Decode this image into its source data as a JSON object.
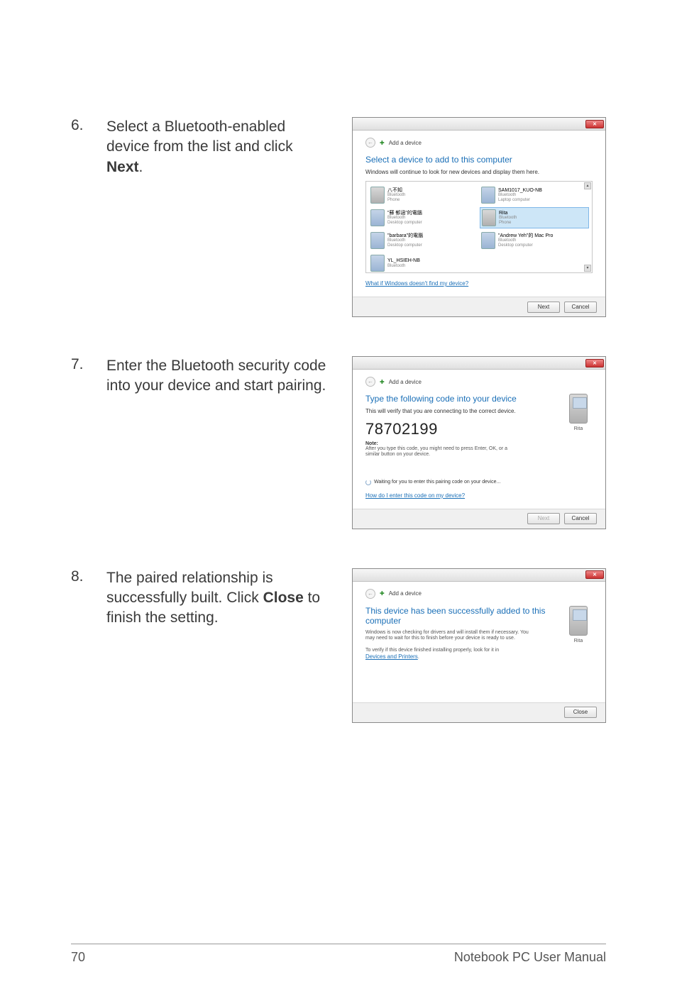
{
  "steps": {
    "s6": {
      "num": "6.",
      "text_pre": "Select a Bluetooth-enabled device from the list and click ",
      "bold": "Next",
      "text_post": "."
    },
    "s7": {
      "num": "7.",
      "text": "Enter the Bluetooth security code into your device and start pairing."
    },
    "s8": {
      "num": "8.",
      "text_pre": "The paired relationship is successfully built. Click ",
      "bold": "Close",
      "text_post": " to finish the setting."
    }
  },
  "dialog_common": {
    "crumb_icon_label": "←",
    "crumb": "Add a device",
    "close_x": "✕"
  },
  "dialog1": {
    "title": "Select a device to add to this computer",
    "subtitle": "Windows will continue to look for new devices and display them here.",
    "devices": [
      {
        "name": "八不知",
        "type1": "Bluetooth",
        "type2": "Phone",
        "icon": "phone"
      },
      {
        "name": "SAM1017_KUO-NB",
        "type1": "Bluetooth",
        "type2": "Laptop computer",
        "icon": "laptop"
      },
      {
        "name": "\"蘇 郁涵\"的電腦",
        "type1": "Bluetooth",
        "type2": "Desktop computer",
        "icon": "laptop"
      },
      {
        "name": "Rita",
        "type1": "Bluetooth",
        "type2": "Phone",
        "icon": "phone",
        "selected": true
      },
      {
        "name": "\"barbara\"的電腦",
        "type1": "Bluetooth",
        "type2": "Desktop computer",
        "icon": "laptop"
      },
      {
        "name": "\"Andrew Yeh\"的 Mac Pro",
        "type1": "Bluetooth",
        "type2": "Desktop computer",
        "icon": "laptop"
      },
      {
        "name": "YL_HSIEH-NB",
        "type1": "Bluetooth",
        "type2": "",
        "icon": "laptop"
      }
    ],
    "link": "What if Windows doesn't find my device?",
    "btn_next": "Next",
    "btn_cancel": "Cancel"
  },
  "dialog2": {
    "title": "Type the following code into your device",
    "subtitle": "This will verify that you are connecting to the correct device.",
    "code": "78702199",
    "note_label": "Note:",
    "note": "After you type this code, you might need to press Enter, OK, or a similar button on your device.",
    "device_name": "Rita",
    "waiting": "Waiting for you to enter this pairing code on your device...",
    "link": "How do I enter this code on my device?",
    "btn_next": "Next",
    "btn_cancel": "Cancel"
  },
  "dialog3": {
    "title": "This device has been successfully added to this computer",
    "line1": "Windows is now checking for drivers and will install them if necessary. You may need to wait for this to finish before your device is ready to use.",
    "line2_pre": "To verify if this device finished installing properly, look for it in ",
    "line2_link": "Devices and Printers",
    "line2_post": ".",
    "device_name": "Rita",
    "btn_close": "Close"
  },
  "footer": {
    "page": "70",
    "manual": "Notebook PC User Manual"
  }
}
